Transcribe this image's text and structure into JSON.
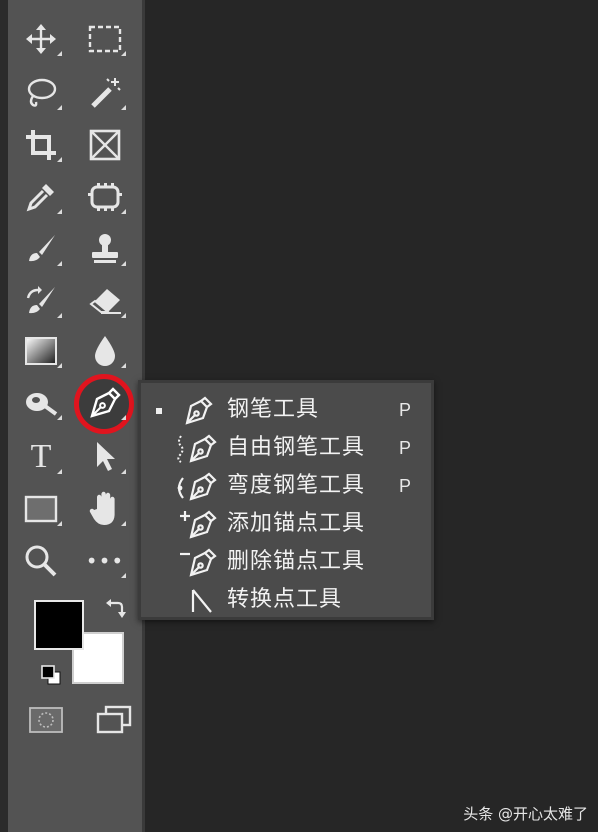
{
  "colors": {
    "toolbar_bg": "#535353",
    "canvas_bg": "#262626",
    "flyout_bg": "#4b4b4b",
    "highlight": "#e0141e",
    "foreground_color": "#000000",
    "background_color": "#ffffff"
  },
  "toolbar": {
    "tools": [
      {
        "id": "move",
        "icon": "move-icon"
      },
      {
        "id": "marquee",
        "icon": "rect-marquee-icon"
      },
      {
        "id": "lasso",
        "icon": "lasso-icon"
      },
      {
        "id": "magic-wand",
        "icon": "magic-wand-icon"
      },
      {
        "id": "crop",
        "icon": "crop-icon"
      },
      {
        "id": "frame",
        "icon": "frame-icon"
      },
      {
        "id": "eyedropper",
        "icon": "eyedropper-icon"
      },
      {
        "id": "patch",
        "icon": "patch-icon"
      },
      {
        "id": "brush",
        "icon": "brush-icon"
      },
      {
        "id": "stamp",
        "icon": "stamp-icon"
      },
      {
        "id": "history-brush",
        "icon": "history-brush-icon"
      },
      {
        "id": "eraser",
        "icon": "eraser-icon"
      },
      {
        "id": "gradient",
        "icon": "gradient-icon"
      },
      {
        "id": "blur",
        "icon": "drop-icon"
      },
      {
        "id": "dodge",
        "icon": "dodge-icon"
      },
      {
        "id": "pen",
        "icon": "pen-icon",
        "selected": true
      },
      {
        "id": "type",
        "icon": "type-icon",
        "label": "T"
      },
      {
        "id": "path-select",
        "icon": "arrow-icon"
      },
      {
        "id": "shape",
        "icon": "rectangle-icon"
      },
      {
        "id": "hand",
        "icon": "hand-icon"
      },
      {
        "id": "zoom",
        "icon": "zoom-icon"
      },
      {
        "id": "more",
        "icon": "more-icon",
        "label": "•••"
      }
    ]
  },
  "flyout": {
    "items": [
      {
        "label": "钢笔工具",
        "shortcut": "P",
        "icon": "pen-icon",
        "active": true
      },
      {
        "label": "自由钢笔工具",
        "shortcut": "P",
        "icon": "freeform-pen-icon"
      },
      {
        "label": "弯度钢笔工具",
        "shortcut": "P",
        "icon": "curvature-pen-icon"
      },
      {
        "label": "添加锚点工具",
        "shortcut": "",
        "icon": "add-anchor-icon"
      },
      {
        "label": "删除锚点工具",
        "shortcut": "",
        "icon": "delete-anchor-icon"
      },
      {
        "label": "转换点工具",
        "shortcut": "",
        "icon": "convert-point-icon"
      }
    ]
  },
  "watermark": "头条 @开心太难了"
}
